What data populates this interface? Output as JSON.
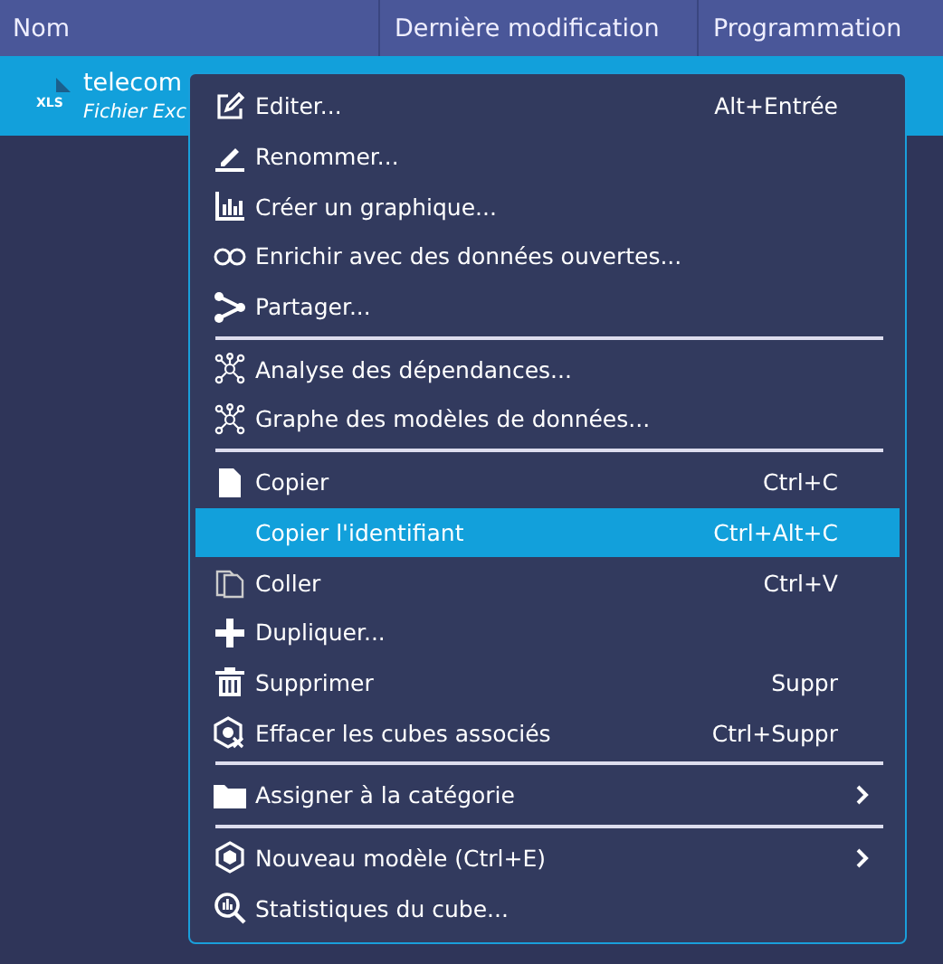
{
  "table": {
    "columns": [
      "Nom",
      "Dernière modification",
      "Programmation"
    ],
    "rows": [
      {
        "name": "telecom",
        "subtitle": "Fichier Exc",
        "type_label": "XLS",
        "selected": true
      }
    ]
  },
  "context_menu": {
    "sections": [
      [
        {
          "label": "Editer...",
          "shortcut": "Alt+Entrée",
          "kind": "edit",
          "selected": false,
          "submenu": false
        },
        {
          "label": "Renommer...",
          "kind": "pencil",
          "selected": false,
          "submenu": false
        },
        {
          "label": "Créer un graphique...",
          "kind": "chart",
          "selected": false,
          "submenu": false
        },
        {
          "label": "Enrichir avec des données ouvertes...",
          "kind": "link",
          "selected": false,
          "submenu": false
        },
        {
          "label": "Partager...",
          "kind": "share",
          "selected": false,
          "submenu": false
        }
      ],
      [
        {
          "label": "Analyse des dépendances...",
          "kind": "graph",
          "selected": false,
          "submenu": false
        },
        {
          "label": "Graphe des modèles de données...",
          "kind": "graph",
          "selected": false,
          "submenu": false
        }
      ],
      [
        {
          "label": "Copier",
          "shortcut": "Ctrl+C",
          "kind": "file",
          "selected": false,
          "submenu": false
        },
        {
          "label": "Copier l'identifiant",
          "shortcut": "Ctrl+Alt+C",
          "kind": "plain",
          "selected": true,
          "submenu": false
        },
        {
          "label": "Coller",
          "shortcut": "Ctrl+V",
          "kind": "paste",
          "selected": false,
          "submenu": false
        },
        {
          "label": "Dupliquer...",
          "kind": "plus",
          "selected": false,
          "submenu": false
        },
        {
          "label": "Supprimer",
          "shortcut": "Suppr",
          "kind": "trash",
          "selected": false,
          "submenu": false
        },
        {
          "label": "Effacer les cubes associés",
          "shortcut": "Ctrl+Suppr",
          "kind": "cube-clear",
          "selected": false,
          "submenu": false
        }
      ],
      [
        {
          "label": "Assigner à la catégorie",
          "kind": "folder",
          "selected": false,
          "submenu": true
        }
      ],
      [
        {
          "label": "Nouveau modèle (Ctrl+E)",
          "kind": "cube",
          "selected": false,
          "submenu": true
        },
        {
          "label": "Statistiques du cube...",
          "kind": "stats",
          "selected": false,
          "submenu": false
        }
      ]
    ]
  }
}
